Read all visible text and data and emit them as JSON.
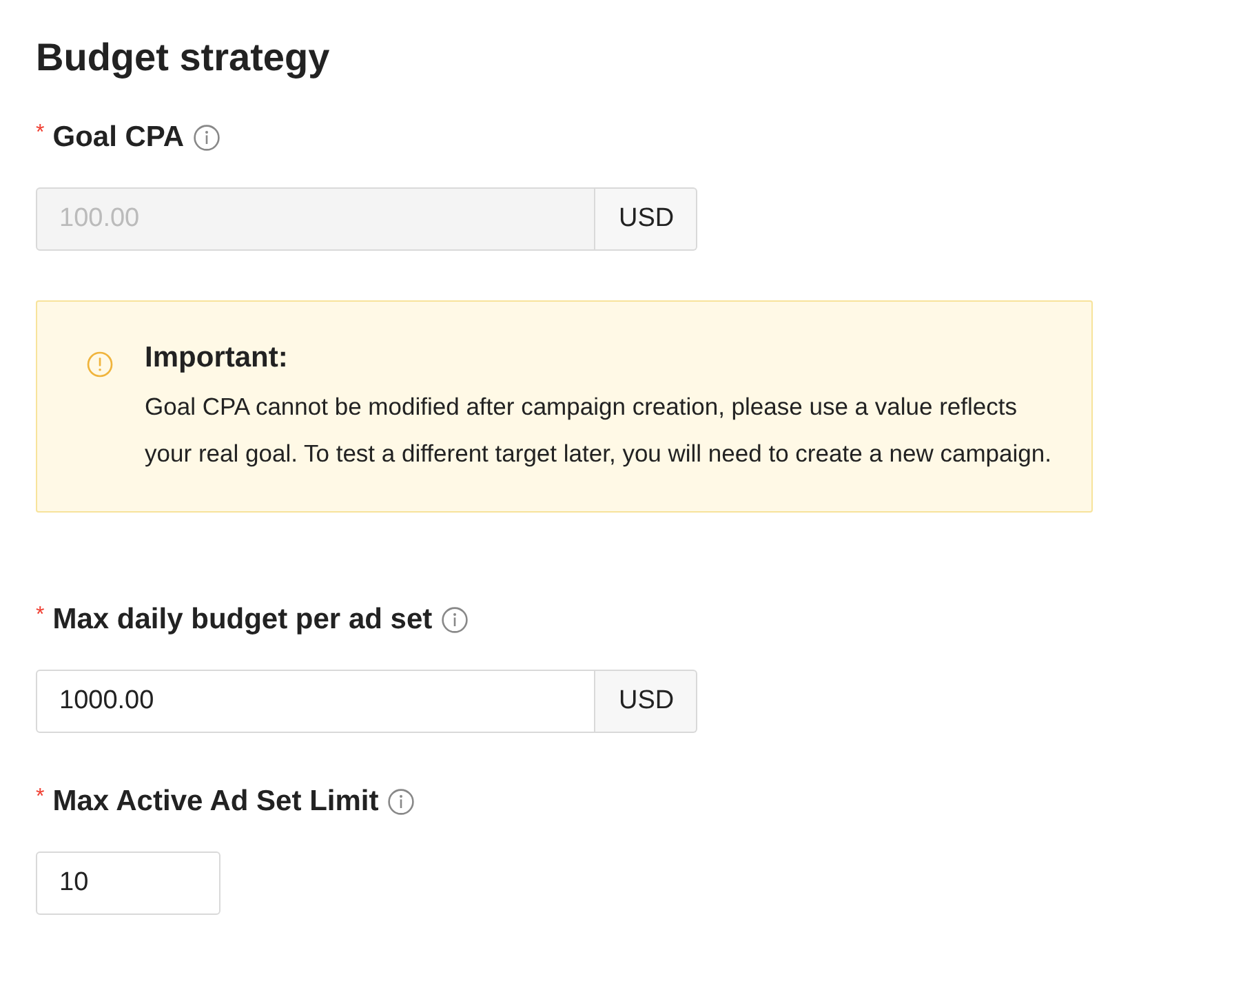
{
  "title": "Budget strategy",
  "sections": [
    {
      "kind": "field",
      "required_mark": "*",
      "label": "Goal CPA",
      "value": "100.00",
      "disabled": true,
      "unit": "USD"
    },
    {
      "kind": "alert",
      "title": "Important:",
      "text": "Goal CPA cannot be modified after campaign creation, please use a value reflects your real goal. To test a different target later, you will need to create a new campaign."
    },
    {
      "kind": "field",
      "required_mark": "*",
      "label": "Max daily budget per ad set",
      "value": "1000.00",
      "disabled": false,
      "unit": "USD"
    },
    {
      "kind": "field",
      "required_mark": "*",
      "label": "Max Active Ad Set Limit",
      "value": "10",
      "disabled": false
    }
  ]
}
